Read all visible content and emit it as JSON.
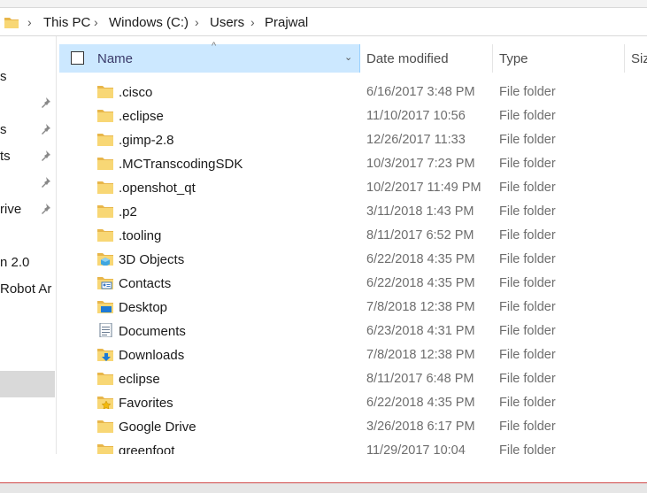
{
  "breadcrumb": [
    "This PC",
    "Windows (C:)",
    "Users",
    "Prajwal"
  ],
  "nav_items": [
    {
      "label": "s",
      "pinned": false
    },
    {
      "label": "",
      "pinned": true
    },
    {
      "label": "s",
      "pinned": true
    },
    {
      "label": "ts",
      "pinned": true
    },
    {
      "label": "",
      "pinned": true
    },
    {
      "label": "rive",
      "pinned": true
    },
    {
      "label": "n 2.0",
      "pinned": false
    },
    {
      "label": " Robot Ar",
      "pinned": false
    }
  ],
  "columns": {
    "name": "Name",
    "date": "Date modified",
    "type": "Type",
    "size": "Siz"
  },
  "files": [
    {
      "name": ".cisco",
      "date": "6/16/2017 3:48 PM",
      "type": "File folder",
      "icon": "folder"
    },
    {
      "name": ".eclipse",
      "date": "11/10/2017 10:56",
      "type": "File folder",
      "icon": "folder"
    },
    {
      "name": ".gimp-2.8",
      "date": "12/26/2017 11:33",
      "type": "File folder",
      "icon": "folder"
    },
    {
      "name": ".MCTranscodingSDK",
      "date": "10/3/2017 7:23 PM",
      "type": "File folder",
      "icon": "folder"
    },
    {
      "name": ".openshot_qt",
      "date": "10/2/2017 11:49 PM",
      "type": "File folder",
      "icon": "folder"
    },
    {
      "name": ".p2",
      "date": "3/11/2018 1:43 PM",
      "type": "File folder",
      "icon": "folder"
    },
    {
      "name": ".tooling",
      "date": "8/11/2017 6:52 PM",
      "type": "File folder",
      "icon": "folder"
    },
    {
      "name": "3D Objects",
      "date": "6/22/2018 4:35 PM",
      "type": "File folder",
      "icon": "3d-objects"
    },
    {
      "name": "Contacts",
      "date": "6/22/2018 4:35 PM",
      "type": "File folder",
      "icon": "contacts"
    },
    {
      "name": "Desktop",
      "date": "7/8/2018 12:38 PM",
      "type": "File folder",
      "icon": "desktop"
    },
    {
      "name": "Documents",
      "date": "6/23/2018 4:31 PM",
      "type": "File folder",
      "icon": "documents"
    },
    {
      "name": "Downloads",
      "date": "7/8/2018 12:38 PM",
      "type": "File folder",
      "icon": "downloads"
    },
    {
      "name": "eclipse",
      "date": "8/11/2017 6:48 PM",
      "type": "File folder",
      "icon": "folder"
    },
    {
      "name": "Favorites",
      "date": "6/22/2018 4:35 PM",
      "type": "File folder",
      "icon": "favorites"
    },
    {
      "name": "Google Drive",
      "date": "3/26/2018 6:17 PM",
      "type": "File folder",
      "icon": "folder"
    },
    {
      "name": "greenfoot",
      "date": "11/29/2017 10:04",
      "type": "File folder",
      "icon": "folder"
    }
  ],
  "colors": {
    "folder": "#f8d775",
    "folder_dark": "#e8b64a",
    "header_selected": "#cce8ff",
    "secondary_text": "#6d6d6d"
  }
}
